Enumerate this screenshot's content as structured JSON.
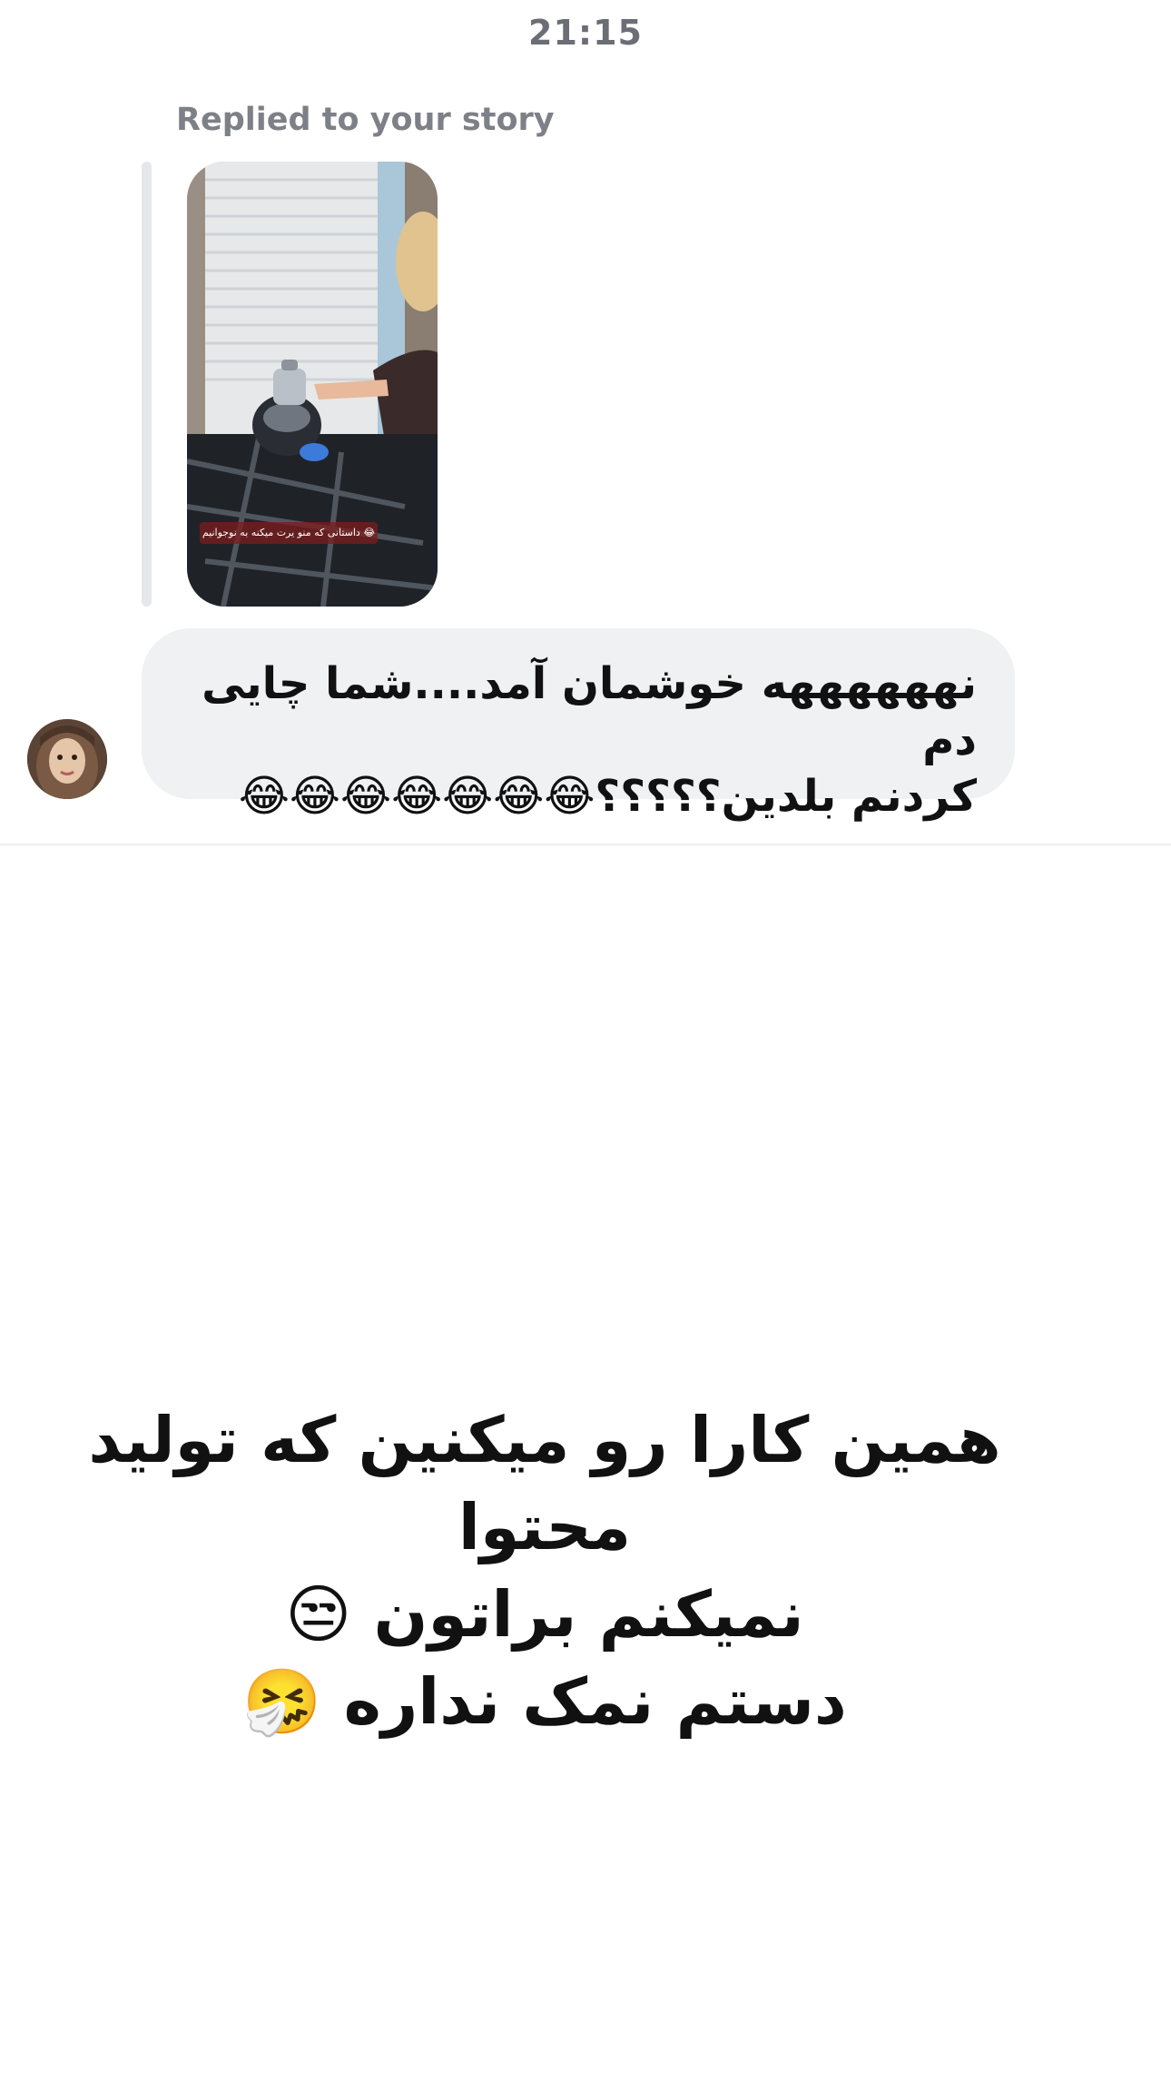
{
  "header": {
    "timestamp": "21:15"
  },
  "story_reply": {
    "label": "Replied to your story",
    "story_caption": "داستانی که منو یرت میکنه به نوجوانیم 😂"
  },
  "message": {
    "text": "نههههههه خوشمان آمد....شما چایی دم\nکردنم بلدین؟؟؟؟؟😂😂😂😂😂😂😂"
  },
  "overlay": {
    "text": "همین کارا رو میکنین که تولید محتوا\nنمیکنم براتون 😒\nدستم نمک نداره 🤧"
  },
  "colors": {
    "background": "#ffffff",
    "bubble": "#f0f1f3",
    "muted_text": "#7d8086"
  }
}
